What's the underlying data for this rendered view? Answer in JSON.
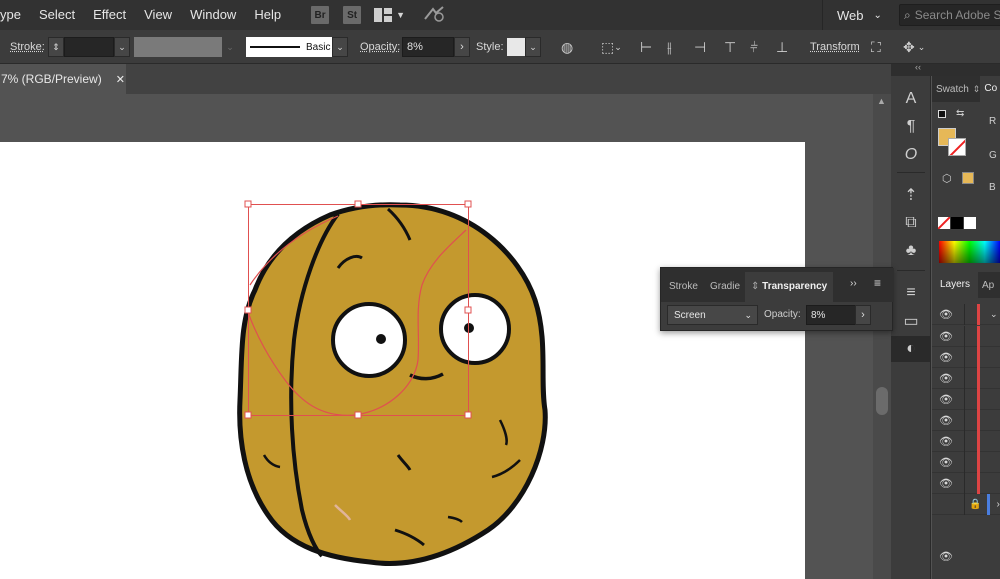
{
  "menu": {
    "items": [
      "ype",
      "Select",
      "Effect",
      "View",
      "Window",
      "Help"
    ],
    "bridge_label": "Br",
    "stock_label": "St",
    "workspace_label": "Web",
    "search_placeholder": "Search Adobe Stock"
  },
  "control_bar": {
    "stroke_label": "Stroke:",
    "brush_label": "Basic",
    "opacity_label": "Opacity:",
    "opacity_value": "8%",
    "style_label": "Style:",
    "transform_label": "Transform"
  },
  "document_tab": {
    "title": "7% (RGB/Preview)",
    "close_glyph": "✕"
  },
  "tools": {
    "icons": [
      "character-icon",
      "paragraph-icon",
      "opentype-icon",
      "symbols-icon",
      "export-icon",
      "club-icon",
      "stroke-lines-icon",
      "gradient-icon",
      "transparency-icon"
    ],
    "glyphs": [
      "A",
      "¶",
      "O",
      "⇡",
      "⧉",
      "♣",
      "≡",
      "▭",
      "◐"
    ]
  },
  "swatch_panel": {
    "tab_swatches": "Swatch",
    "tab_color": "Co",
    "r_label": "R",
    "g_label": "G",
    "b_label": "B",
    "fill_color": "#e6b857"
  },
  "layers_panel": {
    "tab_layers": "Layers",
    "tab_appearance": "Ap",
    "rows": 9
  },
  "transparency_panel": {
    "tab_stroke": "Stroke",
    "tab_gradient": "Gradie",
    "tab_transparency": "Transparency",
    "blend_mode": "Screen",
    "opacity_label": "Opacity:",
    "opacity_value": "8%"
  },
  "artwork": {
    "nut_fill": "#c4992e",
    "selection_color": "#e05050"
  }
}
